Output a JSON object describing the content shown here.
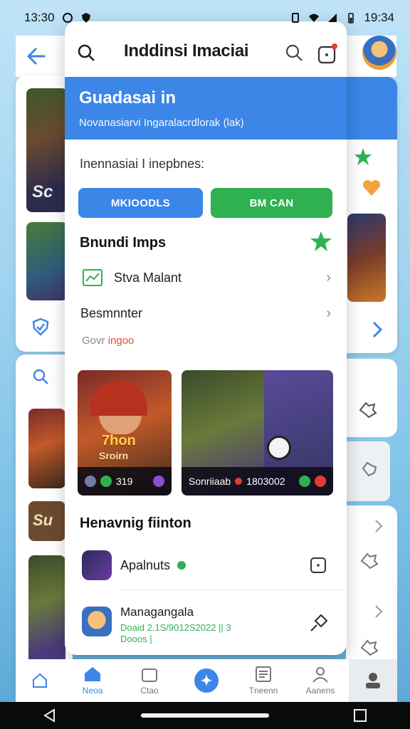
{
  "status_bar": {
    "time_left": "13:30",
    "time_right": "19:34"
  },
  "header": {
    "title": "Inddinsi Imaciai"
  },
  "banner": {
    "title": "Guadasai in",
    "subtitle": "Novanasiarvi Ingaralacrdlorak (lak)"
  },
  "section": {
    "label": "Inennasiai I inepbnes:"
  },
  "buttons": {
    "primary": "MKIOODLS",
    "secondary": "BM CAN"
  },
  "bundle": {
    "heading": "Bnundi Imps",
    "rows": [
      {
        "label": "Stva Malant"
      },
      {
        "label": "Besmnnter"
      }
    ],
    "hint_prefix": "Govr",
    "hint_accent": "ingoo"
  },
  "games": [
    {
      "title_line1": "7hon",
      "title_line2": "Sroirn",
      "caption": "319"
    },
    {
      "title_line1": "",
      "title_line2": "",
      "caption": "Sonriiaab",
      "caption2": "1803002"
    }
  ],
  "featured": {
    "heading": "Henavnig fiinton",
    "items": [
      {
        "name": "Apalnuts",
        "meta": ""
      },
      {
        "name": "Managangala",
        "meta": "Doaid 2.1S/9012S2022 || 3",
        "meta2": "Dooos |"
      }
    ]
  },
  "bottom_nav": {
    "items": [
      {
        "label": "Neoa",
        "active": true
      },
      {
        "label": "Ctao",
        "active": false
      },
      {
        "label": "",
        "active": false
      },
      {
        "label": "Tneenn",
        "active": false
      },
      {
        "label": "Aanens",
        "active": false
      }
    ]
  },
  "left_panel": {
    "game_label": "Sc",
    "game_label2": "Su"
  },
  "colors": {
    "accent_blue": "#3b86e6",
    "accent_green": "#2fb152",
    "badge_red": "#e53935"
  }
}
